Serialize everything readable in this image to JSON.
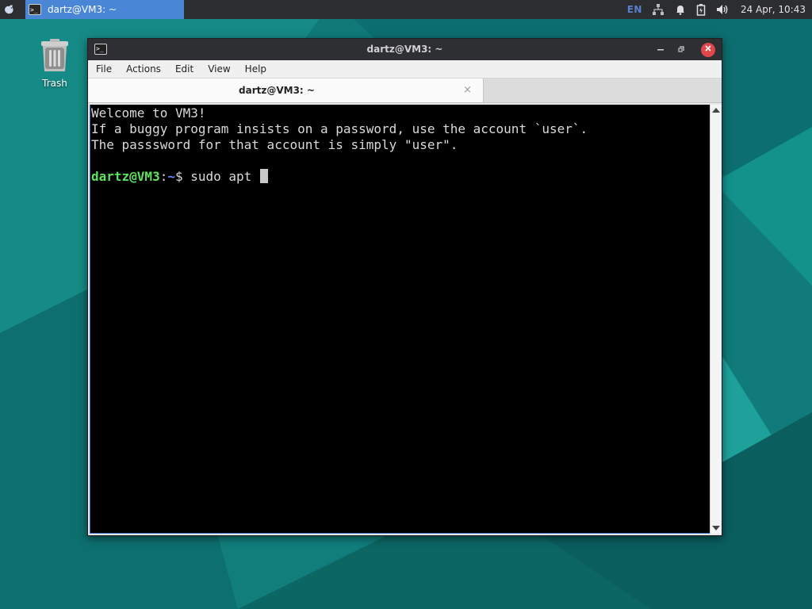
{
  "panel": {
    "task_label": "dartz@VM3: ~",
    "lang": "EN",
    "clock": "24 Apr, 10:43",
    "icons": [
      "app-menu-icon",
      "network-icon",
      "notification-bell-icon",
      "battery-icon",
      "volume-icon"
    ]
  },
  "desktop": {
    "trash_label": "Trash"
  },
  "window": {
    "title": "dartz@VM3: ~",
    "menu": [
      "File",
      "Actions",
      "Edit",
      "View",
      "Help"
    ],
    "tab_title": "dartz@VM3: ~",
    "tab_close": "×",
    "terminal": {
      "lines": [
        "Welcome to VM3!",
        "If a buggy program insists on a password, use the account `user`.",
        "The passsword for that account is simply \"user\".",
        ""
      ],
      "prompt_user": "dartz@VM3",
      "prompt_sep": ":",
      "prompt_path": "~",
      "prompt_symbol": "$ ",
      "command": "sudo apt "
    }
  },
  "colors": {
    "desktop": "#0f7a78",
    "panel": "#2b2d31",
    "task_active": "#4a86d6",
    "close_button": "#e0474c",
    "prompt_user": "#5ce35c",
    "prompt_path": "#6b86ff"
  }
}
